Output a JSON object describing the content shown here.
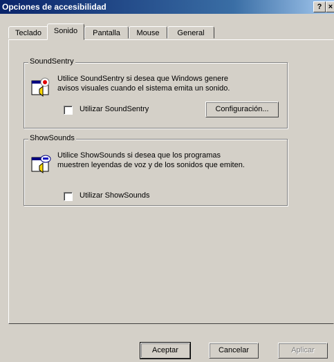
{
  "window": {
    "title": "Opciones de accesibilidad",
    "help_label": "?",
    "close_label": "×"
  },
  "tabs": [
    {
      "label": "Teclado",
      "active": false
    },
    {
      "label": "Sonido",
      "active": true
    },
    {
      "label": "Pantalla",
      "active": false
    },
    {
      "label": "Mouse",
      "active": false
    },
    {
      "label": "General",
      "active": false
    }
  ],
  "soundsentry": {
    "legend": "SoundSentry",
    "line1": "Utilice SoundSentry si desea que Windows genere",
    "line2": "avisos visuales cuando el sistema emita un sonido.",
    "checkbox_label": "Utilizar SoundSentry",
    "checked": false,
    "config_button": "Configuración...",
    "icon": "soundsentry-icon"
  },
  "showsounds": {
    "legend": "ShowSounds",
    "line1": "Utilice ShowSounds si desea que los programas",
    "line2": "muestren leyendas de voz y de los sonidos que emiten.",
    "checkbox_label": "Utilizar ShowSounds",
    "checked": false,
    "icon": "showsounds-icon"
  },
  "footer": {
    "accept": "Aceptar",
    "cancel": "Cancelar",
    "apply": "Aplicar",
    "apply_disabled": true
  }
}
